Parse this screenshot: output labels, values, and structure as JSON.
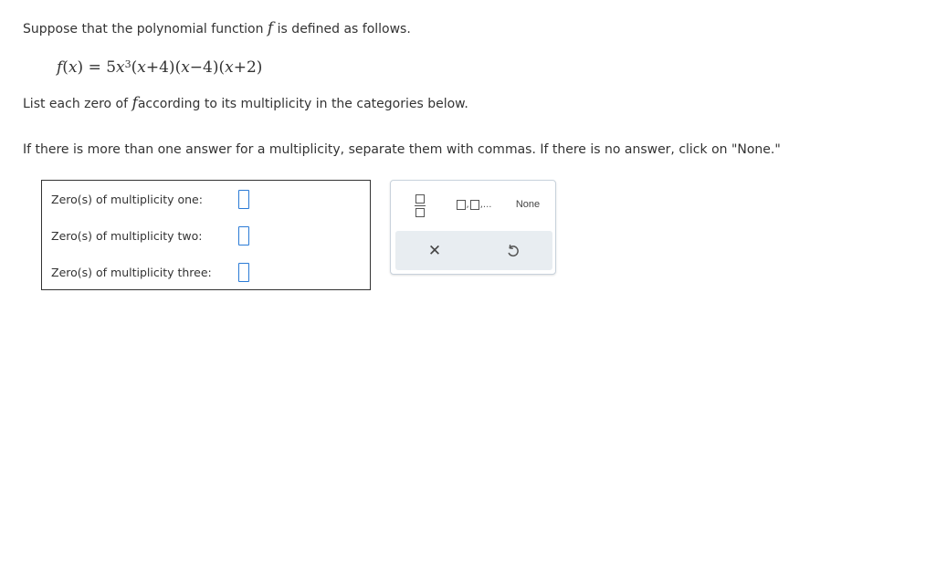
{
  "question": {
    "intro_before_f": "Suppose that the polynomial function",
    "intro_f": "f",
    "intro_after_f": "is defined as follows.",
    "equation": {
      "f": "f",
      "x1": "x",
      "eq": ") = 5",
      "x2": "x",
      "exponent": "3",
      "factor1_open": "(",
      "factor1_x": "x",
      "factor1_rest": "+4)",
      "factor2_open": "(",
      "factor2_x": "x",
      "factor2_rest": "−4)",
      "factor3_open": "(",
      "factor3_x": "x",
      "factor3_rest": "+2)"
    },
    "list_before_f": "List each zero of",
    "list_f": "f",
    "list_after_f": "according to its multiplicity in the categories below.",
    "instructions": "If there is more than one answer for a multiplicity, separate them with commas. If there is no answer, click on \"None.\""
  },
  "answers": {
    "one_label": "Zero(s) of multiplicity one:",
    "one_value": "",
    "two_label": "Zero(s) of multiplicity two:",
    "two_value": "",
    "three_label": "Zero(s) of multiplicity three:",
    "three_value": ""
  },
  "palette": {
    "list_ellipsis": ",...",
    "none_label": "None",
    "clear_symbol": "✕",
    "icons": [
      "fraction-icon",
      "list-icon",
      "clear-icon",
      "undo-icon"
    ]
  },
  "colors": {
    "input_border": "#2b7bd6",
    "toolbar_bg": "#e8edf1",
    "palette_border": "#c8d2dc",
    "text": "#333333"
  }
}
